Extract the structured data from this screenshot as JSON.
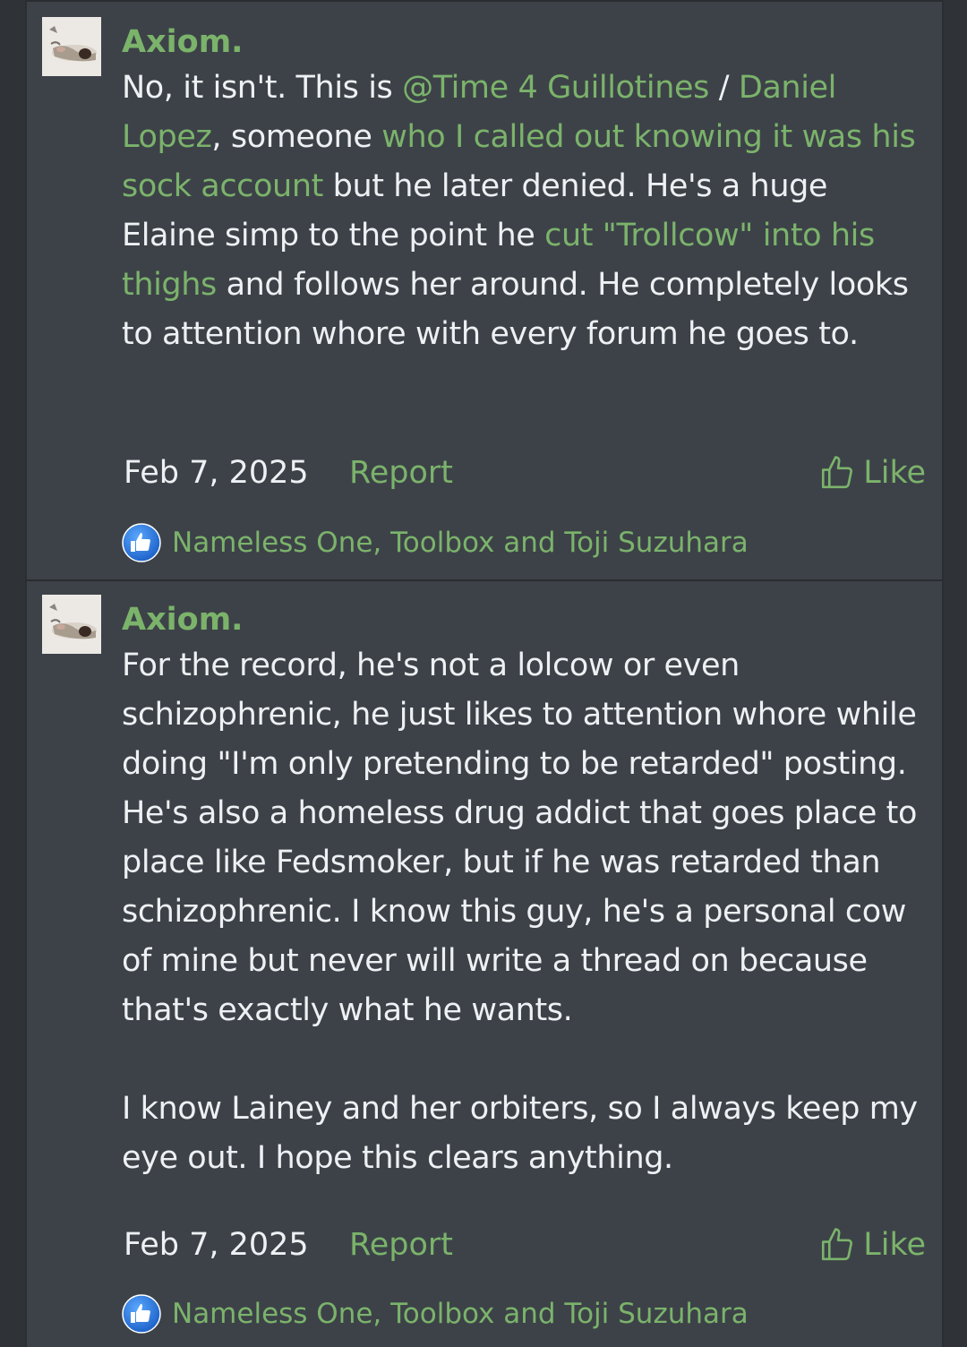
{
  "posts": [
    {
      "username": "Axiom.",
      "paragraphs": [
        [
          {
            "t": "No, it isn't. This is "
          },
          {
            "t": "@Time 4 Guillotines",
            "link": true
          },
          {
            "t": " / "
          },
          {
            "t": "Daniel Lopez",
            "link": true
          },
          {
            "t": ", someone "
          },
          {
            "t": "who I called out knowing it was his sock account",
            "link": true
          },
          {
            "t": " but he later denied. He's a huge Elaine simp to the point he "
          },
          {
            "t": "cut \"Trollcow\" into his thighs",
            "link": true
          },
          {
            "t": " and follows her around. He completely looks to attention whore with every forum he goes to."
          }
        ]
      ],
      "date": "Feb 7, 2025",
      "report_label": "Report",
      "like_label": "Like",
      "reactions_text": "Nameless One, Toolbox and Toji Suzuhara"
    },
    {
      "username": "Axiom.",
      "paragraphs": [
        [
          {
            "t": "For the record, he's not a lolcow or even schizophrenic, he just likes to attention whore while doing \"I'm only pretending to be retarded\" posting. He's also a homeless drug addict that goes place to place like Fedsmoker, but if he was retarded than schizophrenic. I know this guy, he's a personal cow of mine but never will write a thread on because that's exactly what he wants."
          }
        ],
        [
          {
            "t": "I know Lainey and her orbiters, so I always keep my eye out. I hope this clears anything."
          }
        ]
      ],
      "date": "Feb 7, 2025",
      "report_label": "Report",
      "like_label": "Like",
      "reactions_text": "Nameless One, Toolbox and Toji Suzuhara"
    }
  ],
  "colors": {
    "accent": "#7bb36b",
    "panel": "#3d4248",
    "text": "#eef1f4",
    "reaction_badge": "#2f7ee0"
  },
  "icons": {
    "like": "thumbs-up-outline-icon",
    "reaction": "thumbs-up-badge-icon"
  }
}
